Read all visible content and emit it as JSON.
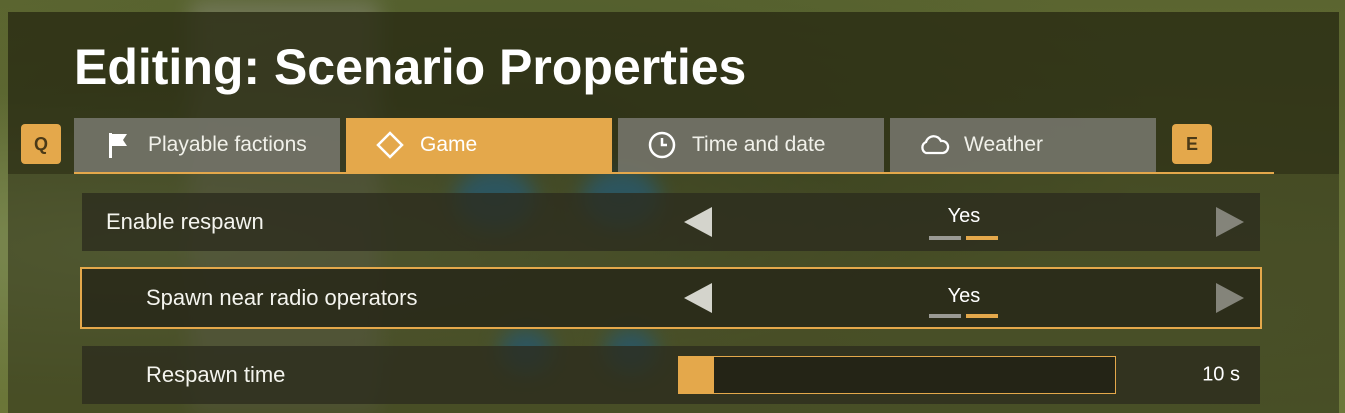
{
  "window": {
    "title": "Editing: Scenario Properties"
  },
  "hotkeys": {
    "prev": "Q",
    "next": "E"
  },
  "tabs": [
    {
      "label": "Playable factions",
      "icon": "flag-icon",
      "active": false
    },
    {
      "label": "Game",
      "icon": "diamond-icon",
      "active": true
    },
    {
      "label": "Time and date",
      "icon": "clock-icon",
      "active": false
    },
    {
      "label": "Weather",
      "icon": "cloud-icon",
      "active": false
    }
  ],
  "settings": [
    {
      "label": "Enable respawn",
      "value": "Yes",
      "type": "selector",
      "options_count": 2,
      "selected_index": 1
    },
    {
      "label": "Spawn near radio operators",
      "value": "Yes",
      "type": "selector",
      "options_count": 2,
      "selected_index": 1,
      "focused": true
    },
    {
      "label": "Respawn time",
      "value": "10 s",
      "type": "slider",
      "fill_fraction": 0.08
    }
  ],
  "colors": {
    "accent": "#e4a84b",
    "pip_inactive": "#9a9a94",
    "tab_inactive": "#76766c",
    "text": "#ffffff"
  }
}
